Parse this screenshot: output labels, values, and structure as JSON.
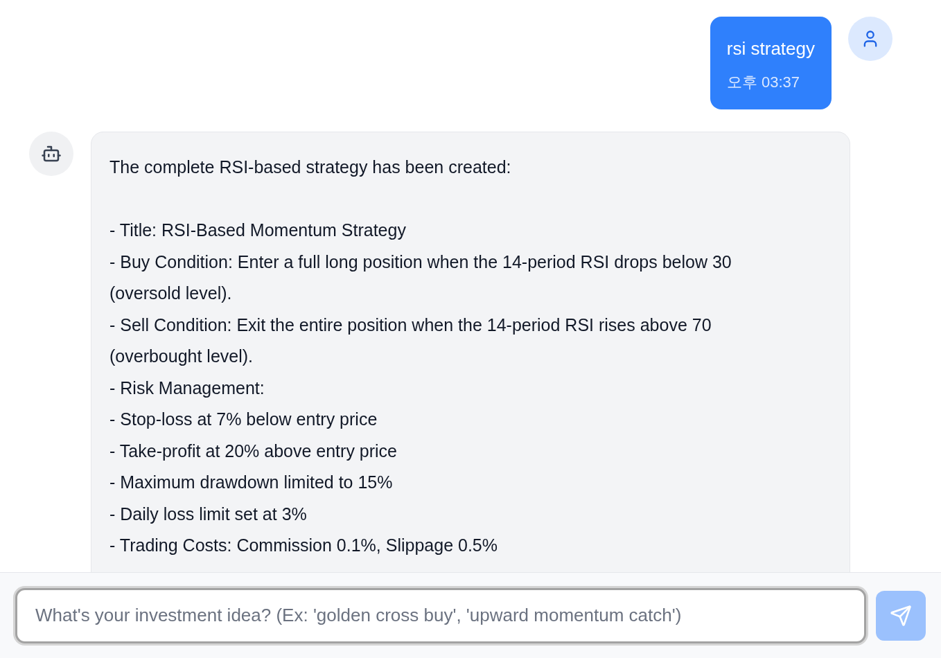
{
  "messages": [
    {
      "kind": "user",
      "text": "rsi strategy",
      "time": "오후 03:37"
    },
    {
      "kind": "bot",
      "intro": "The complete RSI-based strategy has been created:",
      "lines": [
        "- Title: RSI-Based Momentum Strategy",
        "- Buy Condition: Enter a full long position when the 14-period RSI drops below 30 (oversold level).",
        "- Sell Condition: Exit the entire position when the 14-period RSI rises above 70 (overbought level).",
        "- Risk Management:",
        "- Stop-loss at 7% below entry price",
        "- Take-profit at 20% above entry price",
        "- Maximum drawdown limited to 15%",
        "- Daily loss limit set at 3%",
        "- Trading Costs: Commission 0.1%, Slippage 0.5%"
      ]
    }
  ],
  "composer": {
    "placeholder": "What's your investment idea? (Ex: 'golden cross buy', 'upward momentum catch')",
    "send_disabled": true
  }
}
